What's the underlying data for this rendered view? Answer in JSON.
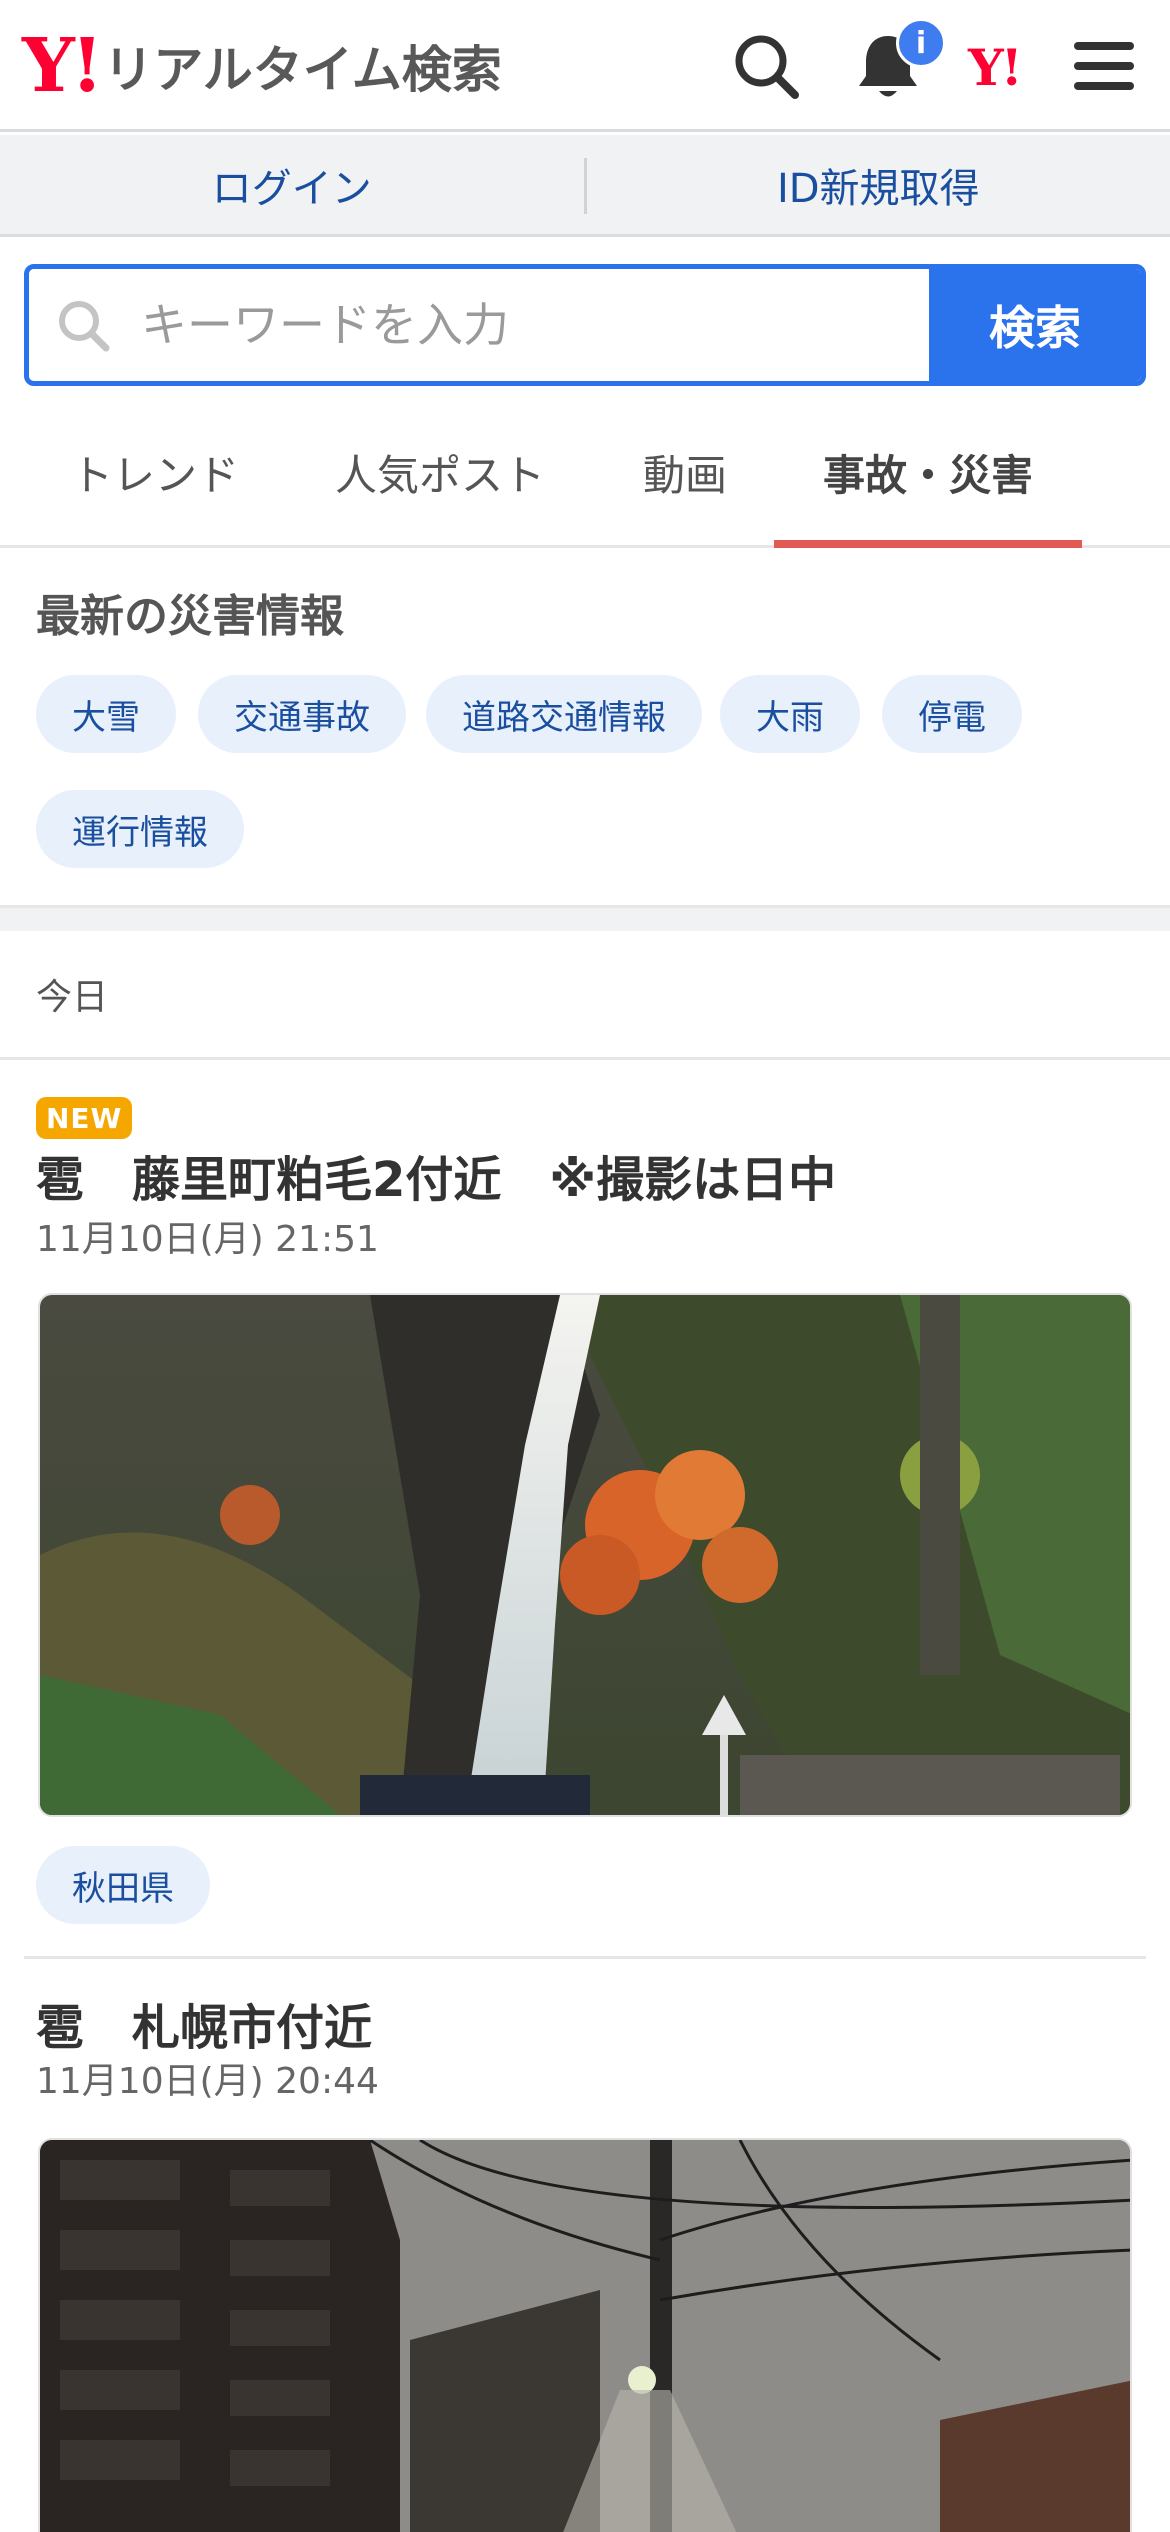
{
  "header": {
    "logo_mark": "Y!",
    "logo_text": "リアルタイム検索",
    "notification_badge": "i",
    "yahoo_mark": "Y!"
  },
  "login_bar": {
    "login": "ログイン",
    "register": "ID新規取得"
  },
  "search": {
    "placeholder": "キーワードを入力",
    "button": "検索"
  },
  "tabs": [
    {
      "label": "トレンド",
      "active": false
    },
    {
      "label": "人気ポスト",
      "active": false
    },
    {
      "label": "動画",
      "active": false
    },
    {
      "label": "事故・災害",
      "active": true
    }
  ],
  "disaster": {
    "title": "最新の災害情報",
    "chips": [
      "大雪",
      "交通事故",
      "道路交通情報",
      "大雨",
      "停電",
      "運行情報"
    ]
  },
  "date_group": "今日",
  "posts": [
    {
      "badge": "NEW",
      "title": "雹　藤里町粕毛2付近　※撮影は日中",
      "time": "11月10日(月) 21:51",
      "image": "waterfall-autumn-photo",
      "tag": "秋田県"
    },
    {
      "title": "雹　札幌市付近",
      "time": "11月10日(月) 20:44",
      "image": "night-snow-street-photo"
    }
  ],
  "colors": {
    "accent_blue": "#2b73ec",
    "link_blue": "#1a4fa0",
    "tab_underline": "#e25a55",
    "brand_red": "#ff0033",
    "new_badge": "#f5a700",
    "chip_bg": "#e8f0fc"
  }
}
